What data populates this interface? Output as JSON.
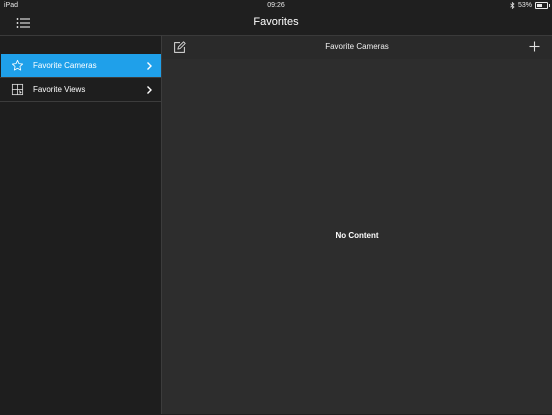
{
  "status_bar": {
    "device": "iPad",
    "time": "09:26",
    "battery_text": "53%",
    "battery_level": 0.53
  },
  "nav": {
    "title": "Favorites"
  },
  "sidebar": {
    "items": [
      {
        "label": "Favorite Cameras",
        "icon": "star-icon",
        "selected": true
      },
      {
        "label": "Favorite Views",
        "icon": "view-layout-icon",
        "selected": false
      }
    ]
  },
  "content": {
    "header_title": "Favorite Cameras",
    "empty_text": "No Content"
  },
  "colors": {
    "accent": "#1fa0ea",
    "background": "#1f1f1f",
    "content_bg": "#2d2d2d"
  }
}
